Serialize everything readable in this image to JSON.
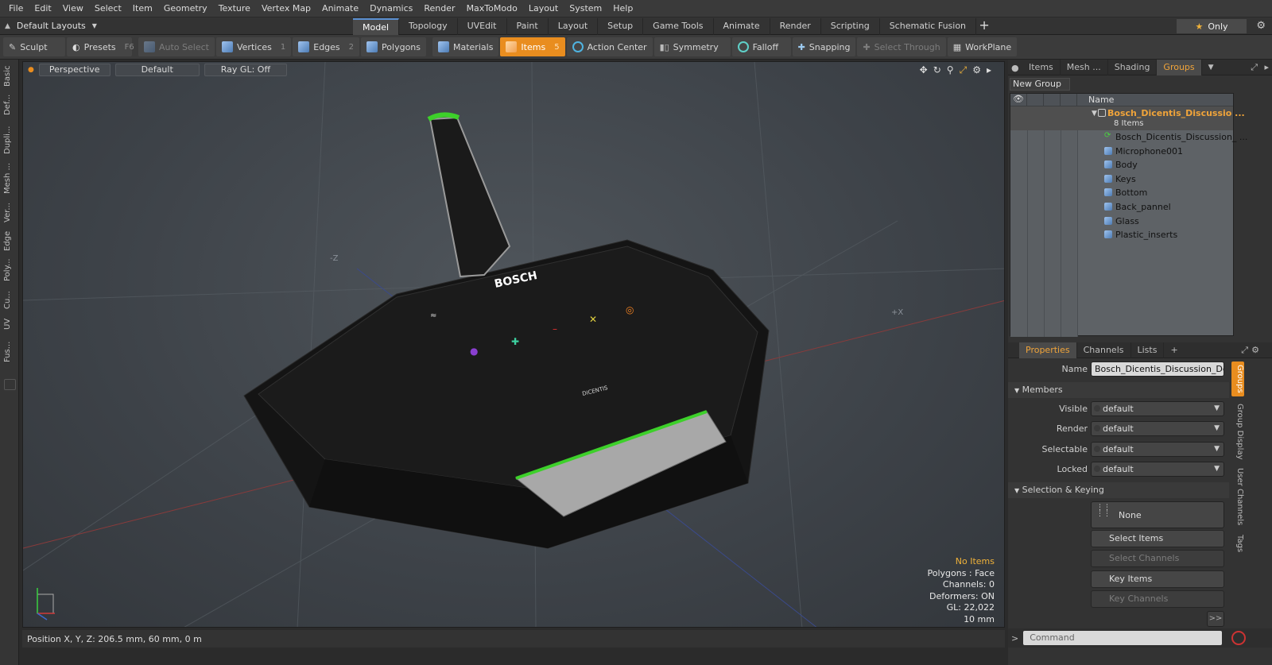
{
  "menubar": {
    "items": [
      "File",
      "Edit",
      "View",
      "Select",
      "Item",
      "Geometry",
      "Texture",
      "Vertex Map",
      "Animate",
      "Dynamics",
      "Render",
      "MaxToModo",
      "Layout",
      "System",
      "Help"
    ]
  },
  "tabbar": {
    "layouts_label": "Default Layouts",
    "tabs": [
      "Model",
      "Topology",
      "UVEdit",
      "Paint",
      "Layout",
      "Setup",
      "Game Tools",
      "Animate",
      "Render",
      "Scripting",
      "Schematic Fusion"
    ],
    "active_tab": "Model",
    "only_label": "Only"
  },
  "toolbar": {
    "sculpt": "Sculpt",
    "presets": "Presets",
    "presets_key": "F6",
    "auto_select": "Auto Select",
    "vertices": "Vertices",
    "vertices_num": "1",
    "edges": "Edges",
    "edges_num": "2",
    "polygons": "Polygons",
    "materials": "Materials",
    "items": "Items",
    "items_num": "5",
    "action_center": "Action Center",
    "symmetry": "Symmetry",
    "falloff": "Falloff",
    "snapping": "Snapping",
    "select_through": "Select Through",
    "workplane": "WorkPlane"
  },
  "left_tabs": [
    "Basic",
    "Def...",
    "Dupli...",
    "Mesh ...",
    "Ver...",
    "Edge",
    "Poly...",
    "Cu...",
    "UV",
    "Fus..."
  ],
  "viewport": {
    "view": "Perspective",
    "shading": "Default",
    "raygl": "Ray GL: Off",
    "axis_neg_z": "-Z",
    "axis_pos_x": "+X",
    "brand_logo": "BOSCH",
    "sub_logo": "DICENTIS",
    "info": {
      "no_items": "No Items",
      "polygons": "Polygons : Face",
      "channels": "Channels: 0",
      "deformers": "Deformers: ON",
      "gl": "GL: 22,022",
      "scale": "10 mm"
    }
  },
  "statusbar": {
    "position": "Position X, Y, Z:  206.5 mm, 60 mm, 0 m"
  },
  "rightpanel": {
    "tabs": [
      "Items",
      "Mesh ...",
      "Shading",
      "Groups"
    ],
    "active_tab": "Groups",
    "new_group": "New Group",
    "name_header": "Name",
    "group": {
      "title": "Bosch_Dicentis_Discussio ...",
      "count": "8 Items",
      "items": [
        "Bosch_Dicentis_Discussion_ ...",
        "Microphone001",
        "Body",
        "Keys",
        "Bottom",
        "Back_pannel",
        "Glass",
        "Plastic_inserts"
      ]
    },
    "prop_tabs": [
      "Properties",
      "Channels",
      "Lists"
    ],
    "name_label": "Name",
    "name_value": "Bosch_Dicentis_Discussion_Devic",
    "members_label": "Members",
    "visible_label": "Visible",
    "render_label": "Render",
    "selectable_label": "Selectable",
    "locked_label": "Locked",
    "default_value": "default",
    "sel_keying_label": "Selection & Keying",
    "none_label": "None",
    "select_items": "Select Items",
    "select_channels": "Select Channels",
    "key_items": "Key Items",
    "key_channels": "Key Channels",
    "more": ">>",
    "side_tabs": [
      "Groups",
      "Group Display",
      "User Channels",
      "Tags"
    ],
    "command_placeholder": "Command"
  }
}
